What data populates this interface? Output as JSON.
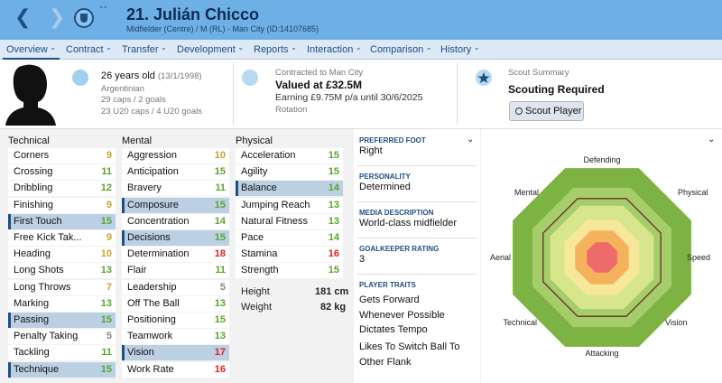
{
  "header": {
    "back_icon": "❮",
    "forward_icon": "❯",
    "sort_icon": "˄˅",
    "title": "21. Julián Chicco",
    "subtitle": "Midfielder (Centre) / M (RL) - Man City (ID:14107685)"
  },
  "tabs": [
    "Overview",
    "Contract",
    "Transfer",
    "Development",
    "Reports",
    "Interaction",
    "Comparison",
    "History"
  ],
  "profile": {
    "age": "26 years old",
    "dob": "(13/1/1998)",
    "nationality": "Argentinian",
    "caps": "29 caps / 2 goals",
    "u20_caps": "23 U20 caps / 4 U20 goals"
  },
  "contract": {
    "line1": "Contracted to Man City",
    "value": "Valued at £32.5M",
    "earning": "Earning £9.75M p/a until 30/6/2025",
    "status": "Rotation"
  },
  "scout": {
    "title": "Scout Summary",
    "status": "Scouting Required",
    "button": "Scout Player"
  },
  "attributes": {
    "technical_title": "Technical",
    "mental_title": "Mental",
    "physical_title": "Physical",
    "technical": [
      {
        "n": "Corners",
        "v": "9"
      },
      {
        "n": "Crossing",
        "v": "11"
      },
      {
        "n": "Dribbling",
        "v": "12"
      },
      {
        "n": "Finishing",
        "v": "9"
      },
      {
        "n": "First Touch",
        "v": "15"
      },
      {
        "n": "Free Kick Tak...",
        "v": "9"
      },
      {
        "n": "Heading",
        "v": "10"
      },
      {
        "n": "Long Shots",
        "v": "13"
      },
      {
        "n": "Long Throws",
        "v": "7"
      },
      {
        "n": "Marking",
        "v": "13"
      },
      {
        "n": "Passing",
        "v": "15"
      },
      {
        "n": "Penalty Taking",
        "v": "5"
      },
      {
        "n": "Tackling",
        "v": "11"
      },
      {
        "n": "Technique",
        "v": "15"
      }
    ],
    "mental": [
      {
        "n": "Aggression",
        "v": "10"
      },
      {
        "n": "Anticipation",
        "v": "15"
      },
      {
        "n": "Bravery",
        "v": "11"
      },
      {
        "n": "Composure",
        "v": "15"
      },
      {
        "n": "Concentration",
        "v": "14"
      },
      {
        "n": "Decisions",
        "v": "15"
      },
      {
        "n": "Determination",
        "v": "18"
      },
      {
        "n": "Flair",
        "v": "11"
      },
      {
        "n": "Leadership",
        "v": "5"
      },
      {
        "n": "Off The Ball",
        "v": "13"
      },
      {
        "n": "Positioning",
        "v": "15"
      },
      {
        "n": "Teamwork",
        "v": "13"
      },
      {
        "n": "Vision",
        "v": "17"
      },
      {
        "n": "Work Rate",
        "v": "16"
      }
    ],
    "physical": [
      {
        "n": "Acceleration",
        "v": "15"
      },
      {
        "n": "Agility",
        "v": "15"
      },
      {
        "n": "Balance",
        "v": "14"
      },
      {
        "n": "Jumping Reach",
        "v": "13"
      },
      {
        "n": "Natural Fitness",
        "v": "13"
      },
      {
        "n": "Pace",
        "v": "14"
      },
      {
        "n": "Stamina",
        "v": "16"
      },
      {
        "n": "Strength",
        "v": "15"
      }
    ],
    "height_label": "Height",
    "height": "181 cm",
    "weight_label": "Weight",
    "weight": "82 kg"
  },
  "details": {
    "foot_label": "PREFERRED FOOT",
    "foot": "Right",
    "personality_label": "PERSONALITY",
    "personality": "Determined",
    "media_label": "MEDIA DESCRIPTION",
    "media": "World-class midfielder",
    "gk_label": "GOALKEEPER RATING",
    "gk": "3",
    "traits_label": "PLAYER TRAITS",
    "traits": [
      "Gets Forward Whenever Possible",
      "Dictates Tempo",
      "Likes To Switch Ball To Other Flank"
    ]
  },
  "radar": {
    "labels": [
      "Defending",
      "Physical",
      "Speed",
      "Vision",
      "Attacking",
      "Technical",
      "Aerial",
      "Mental"
    ]
  },
  "colors": {
    "green": "#5aa52b",
    "yellow": "#caa428",
    "red": "#e02020",
    "grey": "#888888",
    "accent": "#1f4e85",
    "header": "#6eb0e6"
  },
  "icons": {
    "expand": "chevron-down-icon",
    "club": "club-badge-icon",
    "scout": "star-icon"
  }
}
